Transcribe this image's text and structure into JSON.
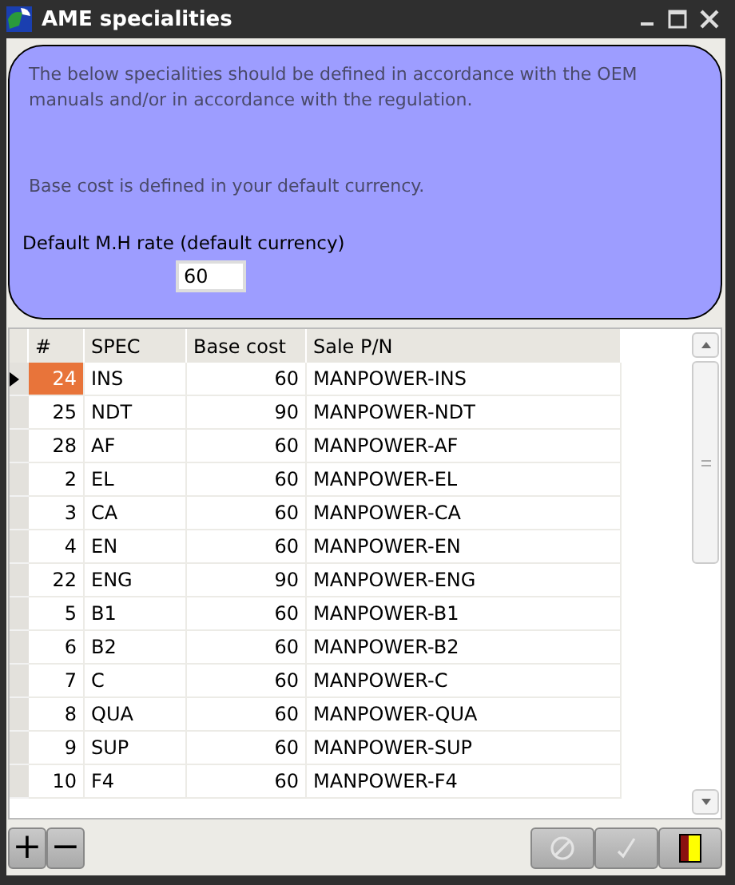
{
  "window": {
    "title": "AME specialities"
  },
  "info": {
    "lines": [
      "The below specialities should be defined in accordance with the OEM manuals and/or in accordance with the regulation.",
      "Base cost is defined in your default currency."
    ],
    "rate_label": "Default M.H rate (default currency)",
    "rate_value": "60"
  },
  "table": {
    "columns": [
      "#",
      "SPEC",
      "Base cost",
      "Sale P/N"
    ],
    "rows": [
      {
        "id": "24",
        "spec": "INS",
        "cost": "60",
        "pn": "MANPOWER-INS",
        "selected": true
      },
      {
        "id": "25",
        "spec": "NDT",
        "cost": "90",
        "pn": "MANPOWER-NDT",
        "selected": false
      },
      {
        "id": "28",
        "spec": "AF",
        "cost": "60",
        "pn": "MANPOWER-AF",
        "selected": false
      },
      {
        "id": "2",
        "spec": "EL",
        "cost": "60",
        "pn": "MANPOWER-EL",
        "selected": false
      },
      {
        "id": "3",
        "spec": "CA",
        "cost": "60",
        "pn": "MANPOWER-CA",
        "selected": false
      },
      {
        "id": "4",
        "spec": "EN",
        "cost": "60",
        "pn": "MANPOWER-EN",
        "selected": false
      },
      {
        "id": "22",
        "spec": "ENG",
        "cost": "90",
        "pn": "MANPOWER-ENG",
        "selected": false
      },
      {
        "id": "5",
        "spec": "B1",
        "cost": "60",
        "pn": "MANPOWER-B1",
        "selected": false
      },
      {
        "id": "6",
        "spec": "B2",
        "cost": "60",
        "pn": "MANPOWER-B2",
        "selected": false
      },
      {
        "id": "7",
        "spec": "C",
        "cost": "60",
        "pn": "MANPOWER-C",
        "selected": false
      },
      {
        "id": "8",
        "spec": "QUA",
        "cost": "60",
        "pn": "MANPOWER-QUA",
        "selected": false
      },
      {
        "id": "9",
        "spec": "SUP",
        "cost": "60",
        "pn": "MANPOWER-SUP",
        "selected": false
      },
      {
        "id": "10",
        "spec": "F4",
        "cost": "60",
        "pn": "MANPOWER-F4",
        "selected": false
      }
    ]
  },
  "toolbar": {
    "left": [
      {
        "label": "+"
      },
      {
        "label": "−"
      }
    ],
    "right": [
      {
        "kind": "cancel",
        "disabled": true
      },
      {
        "kind": "confirm",
        "disabled": true
      },
      {
        "kind": "exit",
        "disabled": false
      }
    ]
  }
}
